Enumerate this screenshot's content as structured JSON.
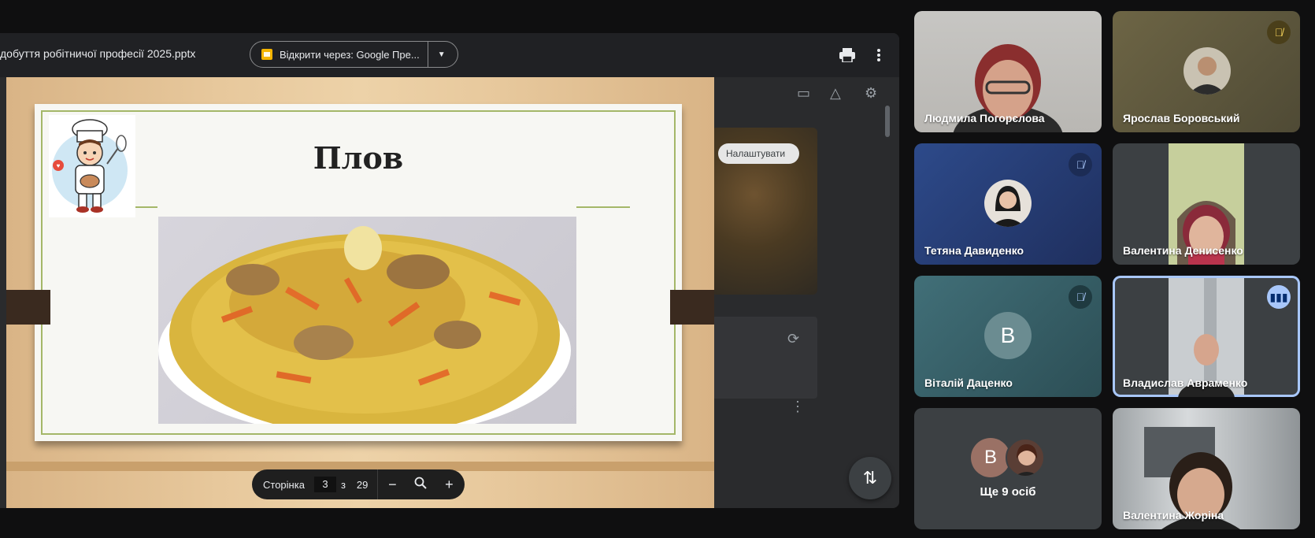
{
  "presentation": {
    "doc_title": "добуття робітничої професії 2025.pptx",
    "open_with_label": "Відкрити через: Google Пре...",
    "print_icon": "print-icon",
    "more_icon": "more-vert-icon"
  },
  "background": {
    "chip_label": "Налаштувати"
  },
  "slide": {
    "title": "Плов"
  },
  "page_nav": {
    "label": "Сторінка",
    "current": "3",
    "of": "з",
    "total": "29"
  },
  "participants": [
    {
      "name": "Людмила Погорєлова",
      "muted": false
    },
    {
      "name": "Ярослав Боровський",
      "muted": true
    },
    {
      "name": "Тетяна Давиденко",
      "muted": true
    },
    {
      "name": "Валентина Денисенко",
      "muted": false
    },
    {
      "name": "Віталій Даценко",
      "muted": true,
      "initial": "В"
    },
    {
      "name": "Владислав Авраменко",
      "speaking": true
    },
    {
      "name": "Валентина Жоріна",
      "muted": false
    }
  ],
  "more_people": {
    "label": "Ще 9 осіб",
    "initial": "В"
  },
  "colors": {
    "tile_blue": "#27407a",
    "tile_teal": "#3e6b74",
    "accent_border": "#a8c7fa"
  }
}
